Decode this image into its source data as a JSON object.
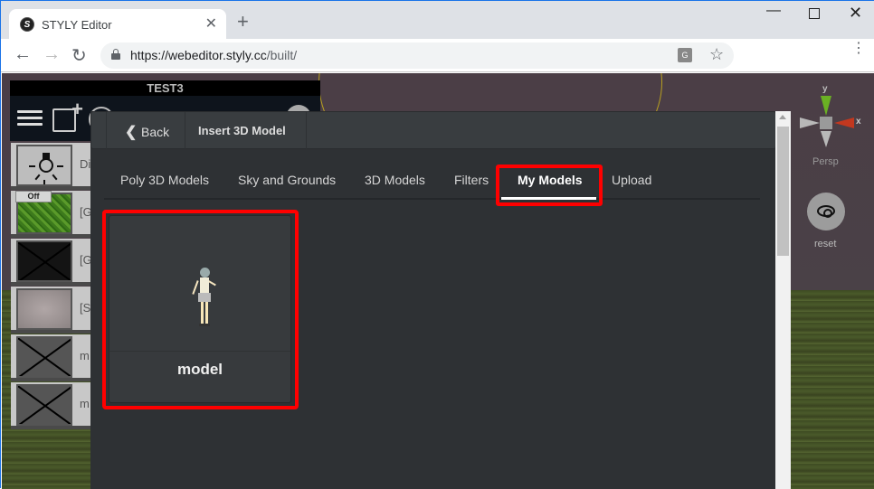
{
  "browser": {
    "tab_title": "STYLY Editor",
    "favicon_letter": "S",
    "tab_close": "✕",
    "new_tab": "+",
    "window_controls": {
      "minimize": "—",
      "close": "✕"
    },
    "url_host": "https://webeditor.styly.cc",
    "url_path": "/built/",
    "nav": {
      "back": "←",
      "forward": "→",
      "reload": "↻"
    },
    "star": "☆",
    "translate_glyph": "G",
    "menu": "⋮"
  },
  "editor": {
    "scene_title": "TEST3",
    "layers": [
      {
        "label": "Di",
        "thumb": "light-bulb",
        "off_badge": null
      },
      {
        "label": "[G",
        "thumb": "grass",
        "off_badge": "Off"
      },
      {
        "label": "[G",
        "thumb": "crossed-black",
        "off_badge": null
      },
      {
        "label": "[S",
        "thumb": "grey-sky",
        "off_badge": null
      },
      {
        "label": "m",
        "thumb": "crossed-model",
        "off_badge": null
      },
      {
        "label": "m",
        "thumb": "crossed-model-figure",
        "off_badge": null
      }
    ],
    "gizmo": {
      "y_label": "y",
      "x_label": "x",
      "projection": "Persp"
    },
    "reset_label": "reset"
  },
  "modal": {
    "back_chevron": "❮",
    "back_label": "Back",
    "title": "Insert 3D Model",
    "tabs": [
      {
        "label": "Poly 3D Models",
        "active": false
      },
      {
        "label": "Sky and Grounds",
        "active": false
      },
      {
        "label": "3D Models",
        "active": false
      },
      {
        "label": "Filters",
        "active": false
      },
      {
        "label": "My Models",
        "active": true
      },
      {
        "label": "Upload",
        "active": false
      }
    ],
    "models": [
      {
        "name": "model"
      }
    ],
    "highlight_color": "#ff0000"
  }
}
